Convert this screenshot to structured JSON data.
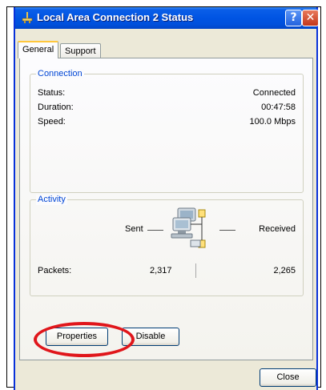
{
  "window": {
    "title": "Local Area Connection 2 Status",
    "help_glyph": "?",
    "close_glyph": "✕"
  },
  "tabs": [
    {
      "label": "General",
      "active": true
    },
    {
      "label": "Support",
      "active": false
    }
  ],
  "connection": {
    "group_title": "Connection",
    "rows": [
      {
        "label": "Status:",
        "value": "Connected"
      },
      {
        "label": "Duration:",
        "value": "00:47:58"
      },
      {
        "label": "Speed:",
        "value": "100.0 Mbps"
      }
    ]
  },
  "activity": {
    "group_title": "Activity",
    "sent_label": "Sent",
    "received_label": "Received",
    "packets_label": "Packets:",
    "packets_sent": "2,317",
    "packets_received": "2,265"
  },
  "buttons": {
    "properties": "Properties",
    "disable": "Disable",
    "close": "Close"
  },
  "colors": {
    "titlebar": "#0054e3",
    "group_title": "#0046d5",
    "annotation_ring": "#e0161b"
  },
  "icons": {
    "title_icon": "network-connection-icon",
    "activity_icon": "network-computers-icon"
  }
}
